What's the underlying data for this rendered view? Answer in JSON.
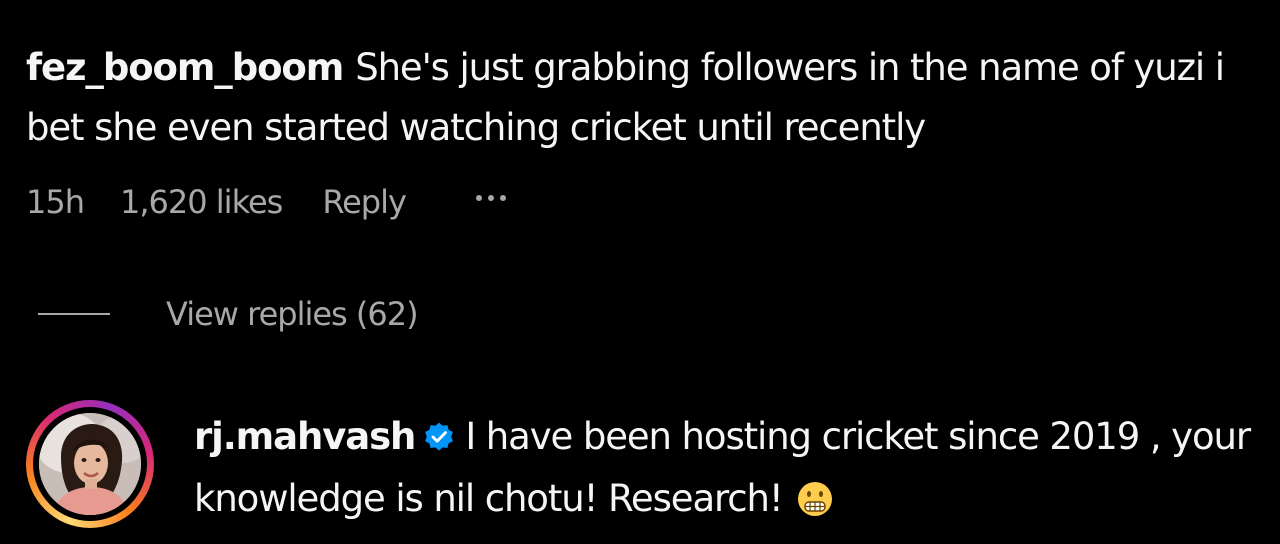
{
  "comment": {
    "username": "fez_boom_boom",
    "text": "She's just grabbing followers in the name of yuzi i bet she even started watching cricket until recently",
    "time": "15h",
    "likes": "1,620 likes",
    "reply_label": "Reply",
    "more_icon": "more-horizontal-icon"
  },
  "view_replies": {
    "label": "View replies (62)"
  },
  "reply": {
    "username": "rj.mahvash",
    "verified": true,
    "verified_icon": "verified-badge-icon",
    "text": "I have been hosting cricket since 2019 , your knowledge is nil chotu! Research!",
    "emoji": "grimacing-face-emoji"
  },
  "colors": {
    "background": "#000000",
    "text": "#f5f5f5",
    "secondary": "#a8a8a8",
    "verified": "#0095f6"
  }
}
